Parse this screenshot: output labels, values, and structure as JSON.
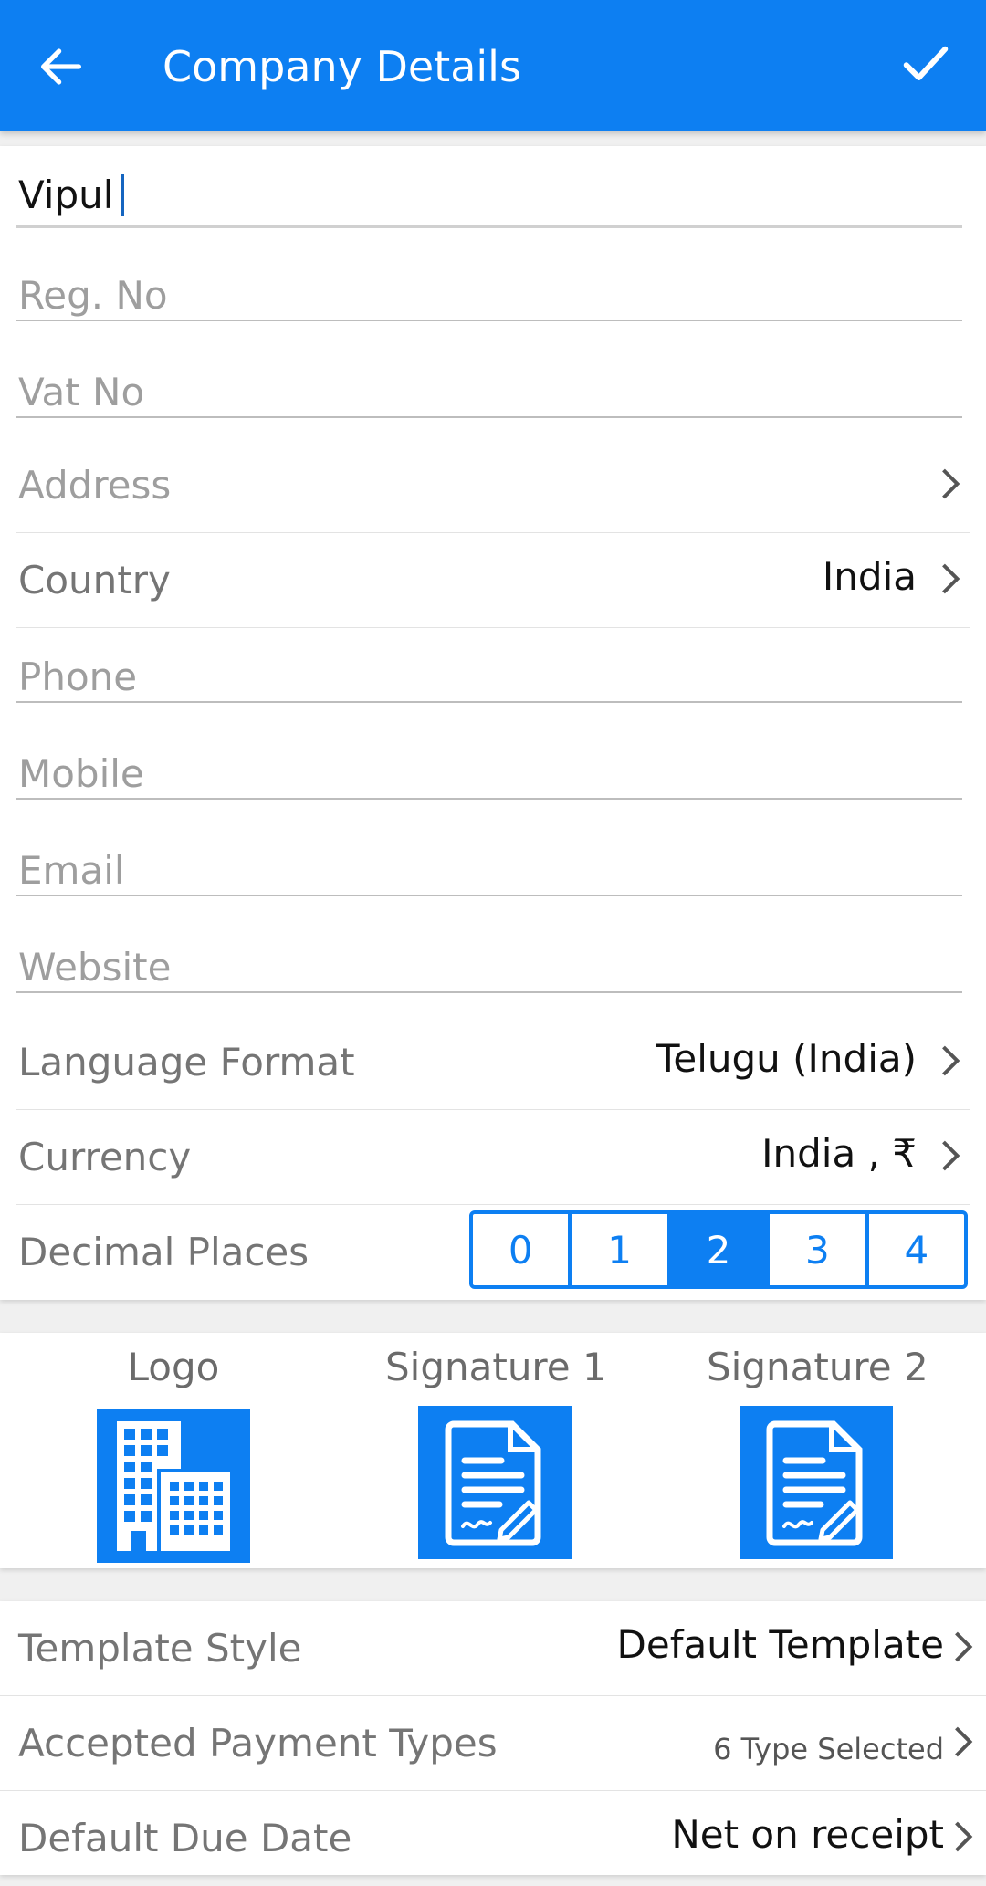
{
  "header": {
    "title": "Company Details",
    "back_icon": "arrow-left-icon",
    "save_icon": "checkmark-icon",
    "color": "#0d7ff2"
  },
  "form": {
    "company_name": {
      "value": "Vipul"
    },
    "reg_no": {
      "placeholder": "Reg. No"
    },
    "vat_no": {
      "placeholder": "Vat No"
    },
    "address": {
      "placeholder": "Address"
    },
    "country": {
      "label": "Country",
      "value": "India"
    },
    "phone": {
      "placeholder": "Phone"
    },
    "mobile": {
      "placeholder": "Mobile"
    },
    "email": {
      "placeholder": "Email"
    },
    "website": {
      "placeholder": "Website"
    },
    "language_format": {
      "label": "Language Format",
      "value": "Telugu (India)"
    },
    "currency": {
      "label": "Currency",
      "value": "India , ₹"
    },
    "decimal_places": {
      "label": "Decimal Places",
      "options": [
        "0",
        "1",
        "2",
        "3",
        "4"
      ],
      "selected": "2"
    }
  },
  "media": {
    "logo": {
      "label": "Logo",
      "icon": "building-icon"
    },
    "signature1": {
      "label": "Signature 1",
      "icon": "signed-document-icon"
    },
    "signature2": {
      "label": "Signature 2",
      "icon": "signed-document-icon"
    }
  },
  "settings": {
    "template_style": {
      "label": "Template Style",
      "value": "Default Template"
    },
    "payment_types": {
      "label": "Accepted Payment Types",
      "value": "6 Type Selected"
    },
    "due_date": {
      "label": "Default Due Date",
      "value": "Net on receipt"
    }
  }
}
